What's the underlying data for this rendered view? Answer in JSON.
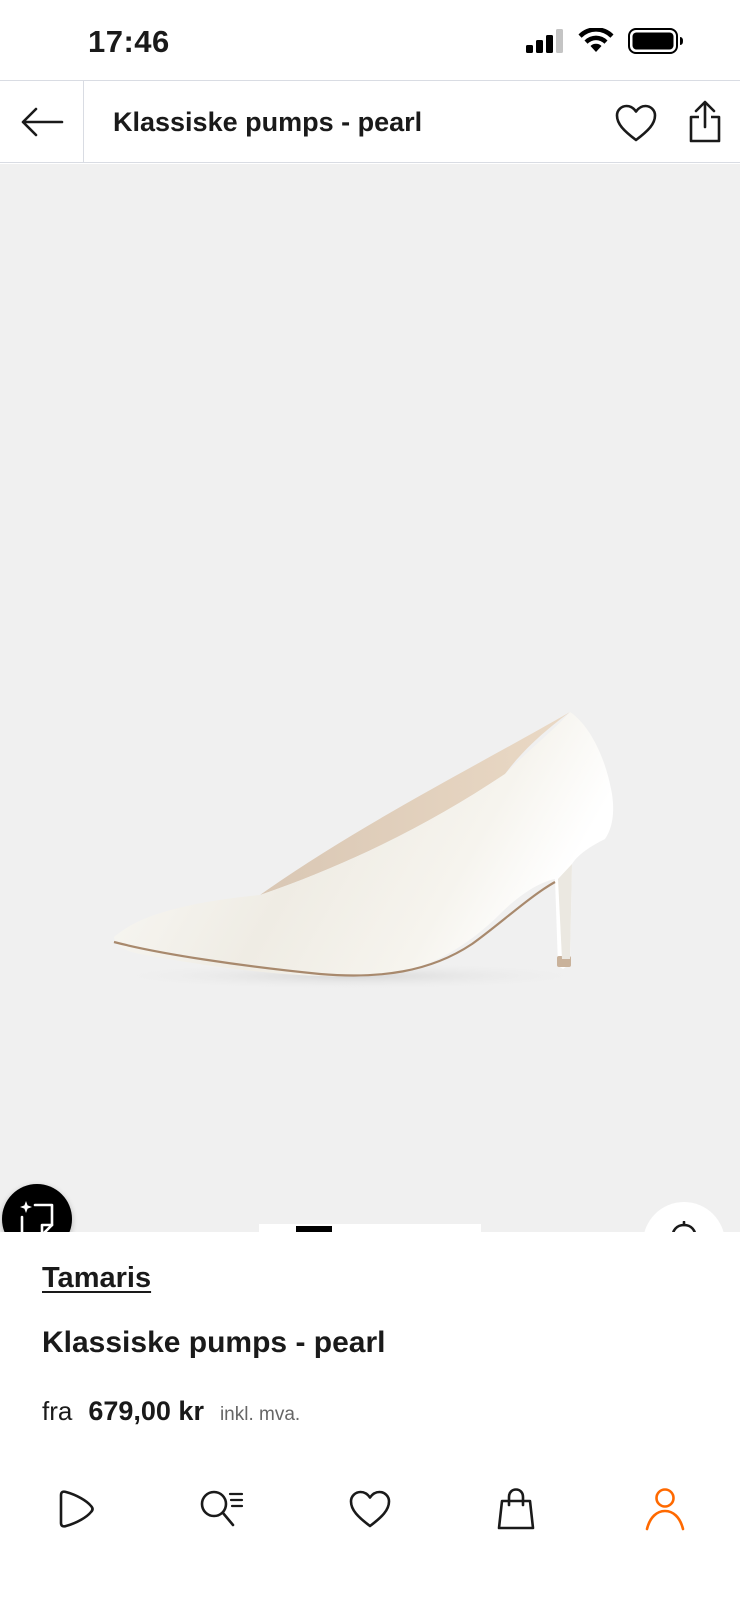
{
  "status_bar": {
    "time": "17:46",
    "icons": [
      "cellular-signal-icon",
      "wifi-icon",
      "battery-icon"
    ]
  },
  "header": {
    "title": "Klassiske pumps - pearl",
    "icons": [
      "back-arrow-icon",
      "heart-icon",
      "share-icon"
    ]
  },
  "gallery": {
    "image_subject": "white pearl pointed pump shoe",
    "background_color": "#f0f0f0",
    "active_image": 1,
    "buttons": [
      "ai-sparkle-icon",
      "bell-icon",
      "heart-icon"
    ]
  },
  "product": {
    "brand": "Tamaris",
    "name": "Klassiske pumps - pearl",
    "price_prefix": "fra",
    "price": "679,00 kr",
    "vat_note": "inkl. mva."
  },
  "bottom_nav": {
    "items": [
      "play-icon",
      "search-list-icon",
      "heart-icon",
      "shopping-bag-icon",
      "profile-icon"
    ],
    "active_item": "profile-icon",
    "active_color": "#ff6900"
  }
}
